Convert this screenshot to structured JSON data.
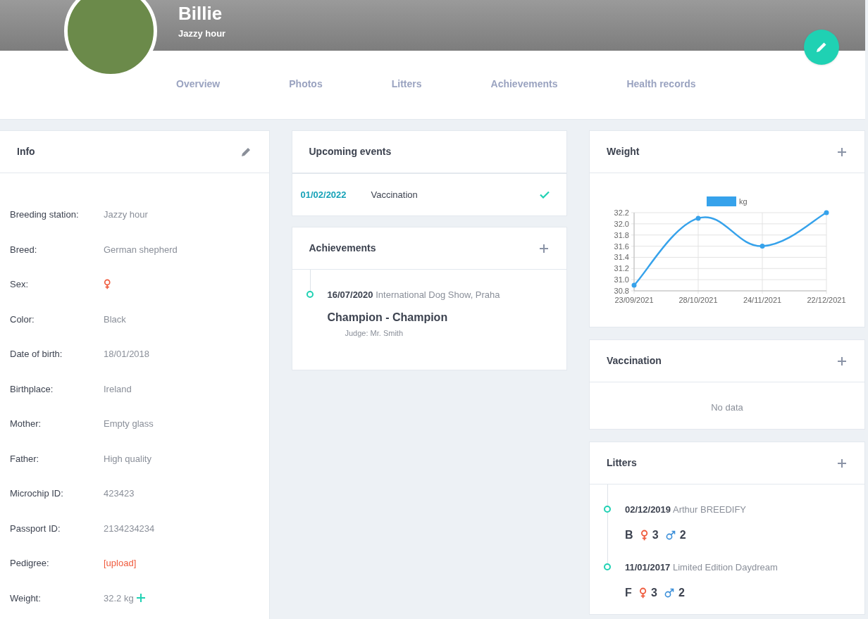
{
  "profile": {
    "name": "Billie",
    "subtitle": "Jazzy hour"
  },
  "tabs": [
    "Overview",
    "Photos",
    "Litters",
    "Achievements",
    "Health records"
  ],
  "info": {
    "title": "Info",
    "rows": [
      {
        "label": "Breeding station:",
        "kind": "text",
        "value": "Jazzy hour"
      },
      {
        "label": "Breed:",
        "kind": "text",
        "value": "German shepherd"
      },
      {
        "label": "Sex:",
        "kind": "female"
      },
      {
        "label": "Color:",
        "kind": "text",
        "value": "Black"
      },
      {
        "label": "Date of birth:",
        "kind": "text",
        "value": "18/01/2018"
      },
      {
        "label": "Birthplace:",
        "kind": "text",
        "value": "Ireland"
      },
      {
        "label": "Mother:",
        "kind": "text",
        "value": "Empty glass"
      },
      {
        "label": "Father:",
        "kind": "text",
        "value": "High quality"
      },
      {
        "label": "Microchip ID:",
        "kind": "text",
        "value": "423423"
      },
      {
        "label": "Passport ID:",
        "kind": "text",
        "value": "2134234234"
      },
      {
        "label": "Pedigree:",
        "kind": "link",
        "value": "[upload]"
      },
      {
        "label": "Weight:",
        "kind": "weight",
        "value": "32.2 kg"
      }
    ]
  },
  "upcoming_events": {
    "title": "Upcoming events",
    "items": [
      {
        "date": "01/02/2022",
        "name": "Vaccination",
        "done": true
      }
    ]
  },
  "achievements": {
    "title": "Achievements",
    "items": [
      {
        "date": "16/07/2020",
        "event": "International Dog Show, Praha",
        "title": "Champion - Champion",
        "judge": "Judge: Mr. Smith"
      }
    ]
  },
  "weight": {
    "title": "Weight",
    "chart_data": {
      "type": "line",
      "grid": true,
      "x": [
        "23/09/2021",
        "28/10/2021",
        "24/11/2021",
        "22/12/2021"
      ],
      "series": [
        {
          "name": "kg",
          "color": "#36a2eb",
          "marker": "circle",
          "values": [
            30.9,
            32.1,
            31.6,
            32.2
          ]
        }
      ],
      "ylim": [
        30.8,
        32.2
      ],
      "yticks": [
        {
          "value": 30.8,
          "label": "30.8"
        },
        {
          "value": 31.0,
          "label": "31.0"
        },
        {
          "value": 31.2,
          "label": "31.2"
        },
        {
          "value": 31.4,
          "label": "31.4"
        },
        {
          "value": 31.6,
          "label": "31.6"
        },
        {
          "value": 31.8,
          "label": "31.8"
        },
        {
          "value": 32.0,
          "label": "32.0"
        },
        {
          "value": 32.2,
          "label": "32.2"
        }
      ]
    }
  },
  "vaccination": {
    "title": "Vaccination",
    "empty_text": "No data"
  },
  "litters": {
    "title": "Litters",
    "items": [
      {
        "date": "02/12/2019",
        "name": "Arthur BREEDIFY",
        "letter": "B",
        "females": "3",
        "males": "2"
      },
      {
        "date": "11/01/2017",
        "name": "Limited Edition Daydream",
        "letter": "F",
        "females": "3",
        "males": "2"
      }
    ]
  }
}
